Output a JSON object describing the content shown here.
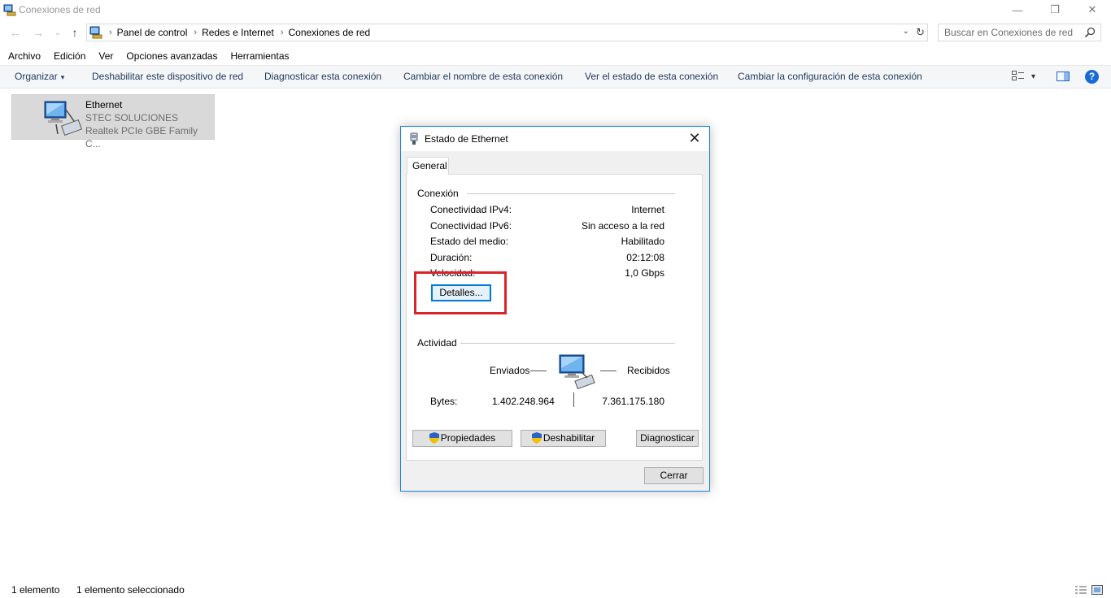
{
  "window": {
    "title": "Conexiones de red",
    "controls": {
      "minimize": "—",
      "restore": "❐",
      "close": "✕"
    }
  },
  "nav": {
    "back_icon": "←",
    "forward_icon": "→",
    "recent_icon": "⌄",
    "up_icon": "↑",
    "breadcrumb": [
      "Panel de control",
      "Redes e Internet",
      "Conexiones de red"
    ],
    "separator": "›",
    "dropdown_icon": "⌄",
    "refresh_icon": "↻"
  },
  "search": {
    "placeholder": "Buscar en Conexiones de red"
  },
  "menu": [
    "Archivo",
    "Edición",
    "Ver",
    "Opciones avanzadas",
    "Herramientas"
  ],
  "commands": {
    "organize": "Organizar",
    "disable": "Deshabilitar este dispositivo de red",
    "diagnose": "Diagnosticar esta conexión",
    "rename": "Cambiar el nombre de esta conexión",
    "status": "Ver el estado de esta conexión",
    "change_settings": "Cambiar la configuración de esta conexión",
    "caret": "▾",
    "help": "?"
  },
  "item": {
    "name": "Ethernet",
    "network": "STEC SOLUCIONES",
    "adapter": "Realtek PCIe GBE Family C..."
  },
  "statusbar": {
    "count": "1 elemento",
    "selected": "1 elemento seleccionado"
  },
  "dialog": {
    "title": "Estado de Ethernet",
    "close_icon": "✕",
    "tab": "General",
    "connection": {
      "heading": "Conexión",
      "rows": [
        {
          "label": "Conectividad IPv4:",
          "value": "Internet"
        },
        {
          "label": "Conectividad IPv6:",
          "value": "Sin acceso a la red"
        },
        {
          "label": "Estado del medio:",
          "value": "Habilitado"
        },
        {
          "label": "Duración:",
          "value": "02:12:08"
        },
        {
          "label": "Velocidad:",
          "value": "1,0 Gbps"
        }
      ],
      "details_button": "Detalles..."
    },
    "activity": {
      "heading": "Actividad",
      "sent_label": "Enviados",
      "received_label": "Recibidos",
      "bytes_label": "Bytes:",
      "bytes_sent": "1.402.248.964",
      "bytes_received": "7.361.175.180"
    },
    "buttons": {
      "properties": "Propiedades",
      "disable": "Deshabilitar",
      "diagnose": "Diagnosticar",
      "close": "Cerrar"
    }
  },
  "colors": {
    "accent": "#0078d7",
    "highlight_box": "#d9242b",
    "command_text": "#1e395b",
    "selected_item_bg": "#d9d9d9"
  }
}
